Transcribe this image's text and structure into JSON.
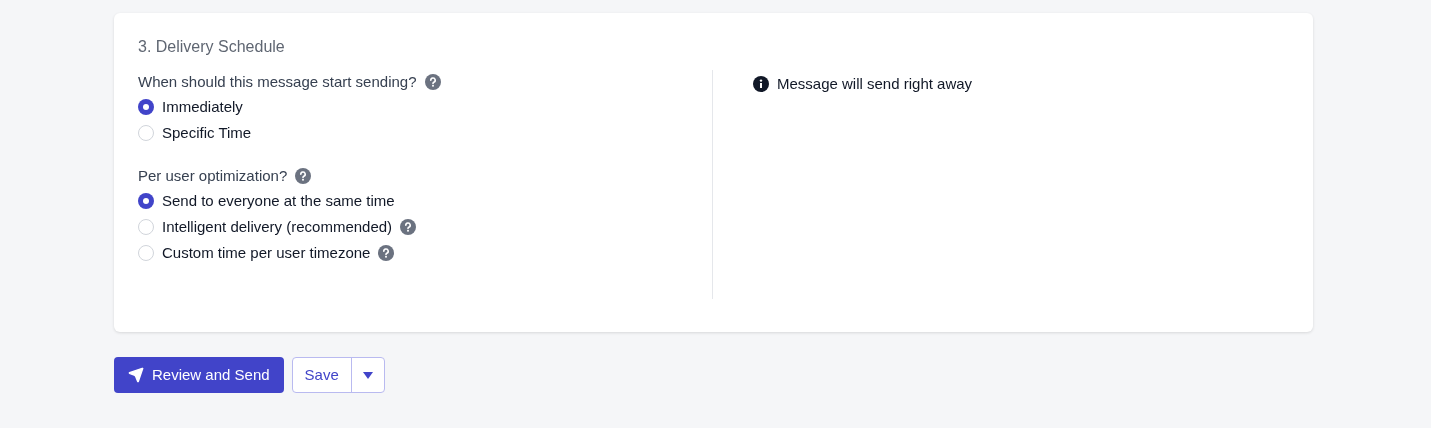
{
  "card": {
    "title": "3. Delivery Schedule",
    "groups": [
      {
        "question": "When should this message start sending?",
        "help": true,
        "options": [
          {
            "label": "Immediately",
            "selected": true,
            "help": false
          },
          {
            "label": "Specific Time",
            "selected": false,
            "help": false
          }
        ]
      },
      {
        "question": "Per user optimization?",
        "help": true,
        "options": [
          {
            "label": "Send to everyone at the same time",
            "selected": true,
            "help": false
          },
          {
            "label": "Intelligent delivery (recommended)",
            "selected": false,
            "help": true
          },
          {
            "label": "Custom time per user timezone",
            "selected": false,
            "help": true
          }
        ]
      }
    ],
    "info": "Message will send right away"
  },
  "actions": {
    "primary": "Review and Send",
    "secondary": "Save"
  }
}
